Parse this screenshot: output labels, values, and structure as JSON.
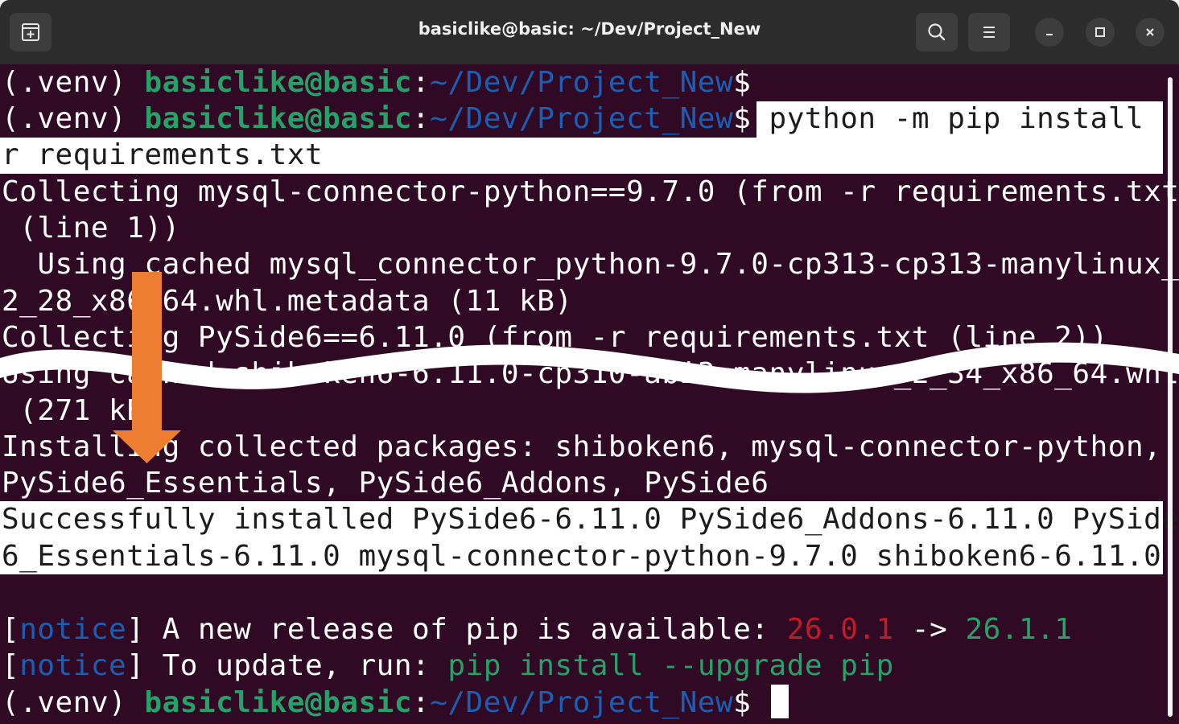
{
  "window": {
    "title": "basiclike@basic: ~/Dev/Project_New"
  },
  "icons": {
    "new_tab": "new-tab-icon",
    "search": "search-icon",
    "menu": "hamburger-menu-icon",
    "minimize": "minimize-icon",
    "maximize": "maximize-icon",
    "close": "close-icon",
    "arrow": "down-arrow-icon"
  },
  "colors": {
    "terminal_bg": "#300a24",
    "prompt_user": "#26a269",
    "prompt_path": "#1a5fb4",
    "highlight": "#ffffff",
    "arrow": "#ed7d31",
    "old_version": "#c01c28",
    "new_version": "#26a269"
  },
  "prompt": {
    "venv": "(.venv) ",
    "user_host": "basiclike@basic",
    "colon": ":",
    "path": "~/Dev/Project_New",
    "dollar": "$"
  },
  "terminal": {
    "command_part1": " python -m pip install -",
    "command_part2": "r requirements.txt",
    "line3": "Collecting mysql-connector-python==9.7.0 (from -r requirements.txt",
    "line4": " (line 1))",
    "line5": "  Using cached mysql_connector_python-9.7.0-cp313-cp313-manylinux_",
    "line6": "2_28_x86_64.whl.metadata (11 kB)",
    "line7": "Collecting PySide6==6.11.0 (from -r requirements.txt (line 2))",
    "line8": "Using cached shiboken6-6.11.0-cp310-abi3-manylinux_2_34_x86_64.whl",
    "line9": " (271 kB)",
    "line10": "Installing collected packages: shiboken6, mysql-connector-python,",
    "line11": "PySide6_Essentials, PySide6_Addons, PySide6",
    "success1": "Successfully installed PySide6-6.11.0 PySide6_Addons-6.11.0 PySide",
    "success2": "6_Essentials-6.11.0 mysql-connector-python-9.7.0 shiboken6-6.11.0",
    "notice_open": "[",
    "notice_word": "notice",
    "notice_close": "]",
    "notice1_text": " A new release of pip is available: ",
    "old_version": "26.0.1",
    "arrow_text": " -> ",
    "new_version": "26.1.1",
    "notice2_text": " To update, run: ",
    "upgrade_cmd": "pip install --upgrade pip"
  }
}
